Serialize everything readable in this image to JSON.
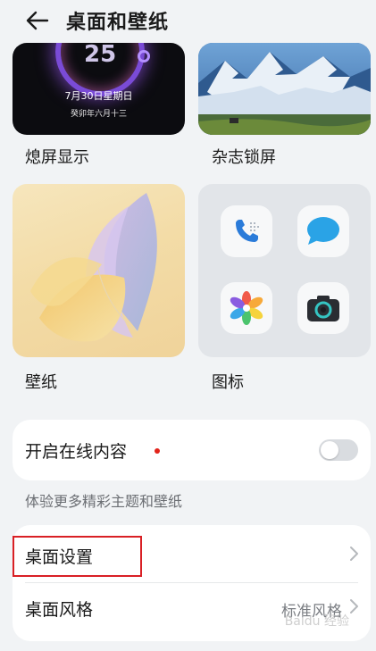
{
  "header": {
    "title": "桌面和壁纸"
  },
  "aod": {
    "time": "25",
    "date": "7月30日星期日",
    "lunar": "癸卯年六月十三",
    "label": "熄屏显示"
  },
  "magazine": {
    "label": "杂志锁屏"
  },
  "wallpaper": {
    "label": "壁纸"
  },
  "icons": {
    "label": "图标",
    "apps": [
      "phone-icon",
      "messages-icon",
      "gallery-icon",
      "camera-icon"
    ]
  },
  "online": {
    "label": "开启在线内容",
    "toggle_on": false,
    "description": "体验更多精彩主题和壁纸"
  },
  "settings": {
    "desktop_settings": "桌面设置",
    "desktop_style": "桌面风格",
    "desktop_style_value": "标准风格"
  },
  "watermark": "Baidu 经验",
  "colors": {
    "accent_red": "#d92025",
    "background": "#f1f3f5",
    "card": "#ffffff"
  }
}
